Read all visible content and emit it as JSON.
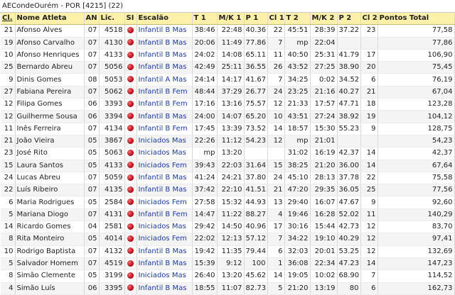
{
  "header": {
    "title": "AECondeOurém - POR [4215] (22)"
  },
  "columns": [
    "Cl.",
    "Nome Atleta",
    "AN",
    "Lic.",
    "SI",
    "Escalão",
    "T 1",
    "M/K 1",
    "P 1",
    "Cl 1",
    "T 2",
    "M/K 2",
    "P 2",
    "Cl 2",
    "Pontos Total"
  ],
  "rows": [
    [
      "21",
      "Afonso Alves",
      "07",
      "4518",
      "dot",
      "Infantil B Mas",
      "38:46",
      "22:48",
      "40.36",
      "22",
      "45:51",
      "28:39",
      "37.22",
      "23",
      "77,58"
    ],
    [
      "19",
      "Afonso Carvalho",
      "07",
      "4130",
      "dot",
      "Infantil B Mas",
      "20:06",
      "11:49",
      "77.86",
      "7",
      "mp",
      "22:04",
      "",
      "",
      "77,86"
    ],
    [
      "10",
      "Afonso Henriques",
      "07",
      "4133",
      "dot",
      "Infantil B Mas",
      "24:02",
      "14:08",
      "65.11",
      "11",
      "40:50",
      "25:31",
      "41.79",
      "17",
      "106,90"
    ],
    [
      "25",
      "Bernardo Abreu",
      "07",
      "5056",
      "dot",
      "Infantil B Mas",
      "42:49",
      "25:11",
      "36.55",
      "26",
      "43:52",
      "27:25",
      "38.90",
      "20",
      "75,45"
    ],
    [
      "9",
      "Dinis Gomes",
      "08",
      "5053",
      "dot",
      "Infantil A Mas",
      "24:14",
      "14:17",
      "41.67",
      "7",
      "34:25",
      "0:02",
      "34.52",
      "6",
      "76,19"
    ],
    [
      "27",
      "Fabiana Pereira",
      "07",
      "5062",
      "dot",
      "Infantil B Fem",
      "48:44",
      "37:29",
      "26.77",
      "24",
      "23:25",
      "21:16",
      "40.27",
      "21",
      "67,04"
    ],
    [
      "12",
      "Filipa Gomes",
      "06",
      "3393",
      "dot",
      "Infantil B Fem",
      "17:16",
      "13:16",
      "75.57",
      "12",
      "21:33",
      "17:57",
      "47.71",
      "18",
      "123,28"
    ],
    [
      "12",
      "Guilherme Sousa",
      "06",
      "3394",
      "dot",
      "Infantil B Mas",
      "24:00",
      "14:07",
      "65.20",
      "10",
      "43:51",
      "27:24",
      "38.92",
      "19",
      "104,12"
    ],
    [
      "11",
      "Inês Ferreira",
      "07",
      "4134",
      "dot",
      "Infantil B Fem",
      "17:45",
      "13:39",
      "73.52",
      "14",
      "18:57",
      "15:30",
      "55.23",
      "9",
      "128,75"
    ],
    [
      "21",
      "João Vieira",
      "05",
      "3867",
      "dot",
      "Iniciados Mas",
      "22:26",
      "11:12",
      "54.23",
      "12",
      "mp",
      "21:01",
      "",
      "",
      "54,23"
    ],
    [
      "23",
      "José Rito",
      "05",
      "5063",
      "dot",
      "Iniciados Mas",
      "mp",
      "13:20",
      "",
      "",
      "31:02",
      "16:19",
      "42.37",
      "14",
      "42,37"
    ],
    [
      "15",
      "Laura Santos",
      "05",
      "4133",
      "dot",
      "Iniciados Fem",
      "39:43",
      "22:03",
      "31.64",
      "15",
      "38:25",
      "21:20",
      "36.00",
      "14",
      "67,64"
    ],
    [
      "24",
      "Lucas Abreu",
      "07",
      "5059",
      "dot",
      "Infantil B Mas",
      "41:24",
      "24:21",
      "37.80",
      "24",
      "45:10",
      "28:13",
      "37.78",
      "22",
      "75,58"
    ],
    [
      "22",
      "Luís Ribeiro",
      "07",
      "4135",
      "dot",
      "Infantil B Mas",
      "37:42",
      "22:10",
      "41.51",
      "21",
      "47:20",
      "29:35",
      "36.05",
      "25",
      "77,56"
    ],
    [
      "6",
      "Maria Rodrigues",
      "05",
      "2584",
      "dot",
      "Iniciados Fem",
      "27:58",
      "15:32",
      "44.93",
      "13",
      "29:40",
      "16:07",
      "47.67",
      "9",
      "92,60"
    ],
    [
      "5",
      "Mariana Diogo",
      "07",
      "4131",
      "dot",
      "Infantil B Fem",
      "14:47",
      "11:22",
      "88.27",
      "4",
      "19:46",
      "16:28",
      "52.02",
      "11",
      "140,29"
    ],
    [
      "14",
      "Ricardo Gomes",
      "04",
      "2581",
      "dot",
      "Iniciados Mas",
      "29:42",
      "14:50",
      "40.96",
      "17",
      "30:16",
      "15:44",
      "42.73",
      "12",
      "83,70"
    ],
    [
      "8",
      "Rita Monteiro",
      "05",
      "4014",
      "dot",
      "Iniciados Fem",
      "22:02",
      "12:13",
      "57.12",
      "7",
      "34:22",
      "19:10",
      "40.29",
      "12",
      "97,41"
    ],
    [
      "10",
      "Rodrigo Baptista",
      "07",
      "4132",
      "dot",
      "Infantil B Mas",
      "19:42",
      "11:35",
      "79.44",
      "6",
      "32:03",
      "20:01",
      "53.25",
      "12",
      "132,69"
    ],
    [
      "5",
      "Salvador Homem",
      "07",
      "4519",
      "dot",
      "Infantil B Mas",
      "15:39",
      "9:12",
      "100",
      "1",
      "36:08",
      "22:34",
      "47.23",
      "14",
      "147,23"
    ],
    [
      "8",
      "Simão Clemente",
      "05",
      "3199",
      "dot",
      "Iniciados Mas",
      "26:40",
      "13:20",
      "45.62",
      "14",
      "19:05",
      "10:02",
      "68.90",
      "7",
      "114,52"
    ],
    [
      "4",
      "Simão Luís",
      "06",
      "3395",
      "dot",
      "Infantil B Mas",
      "18:55",
      "11:07",
      "82.73",
      "5",
      "21:20",
      "13:19",
      "80",
      "6",
      "162,73"
    ]
  ]
}
